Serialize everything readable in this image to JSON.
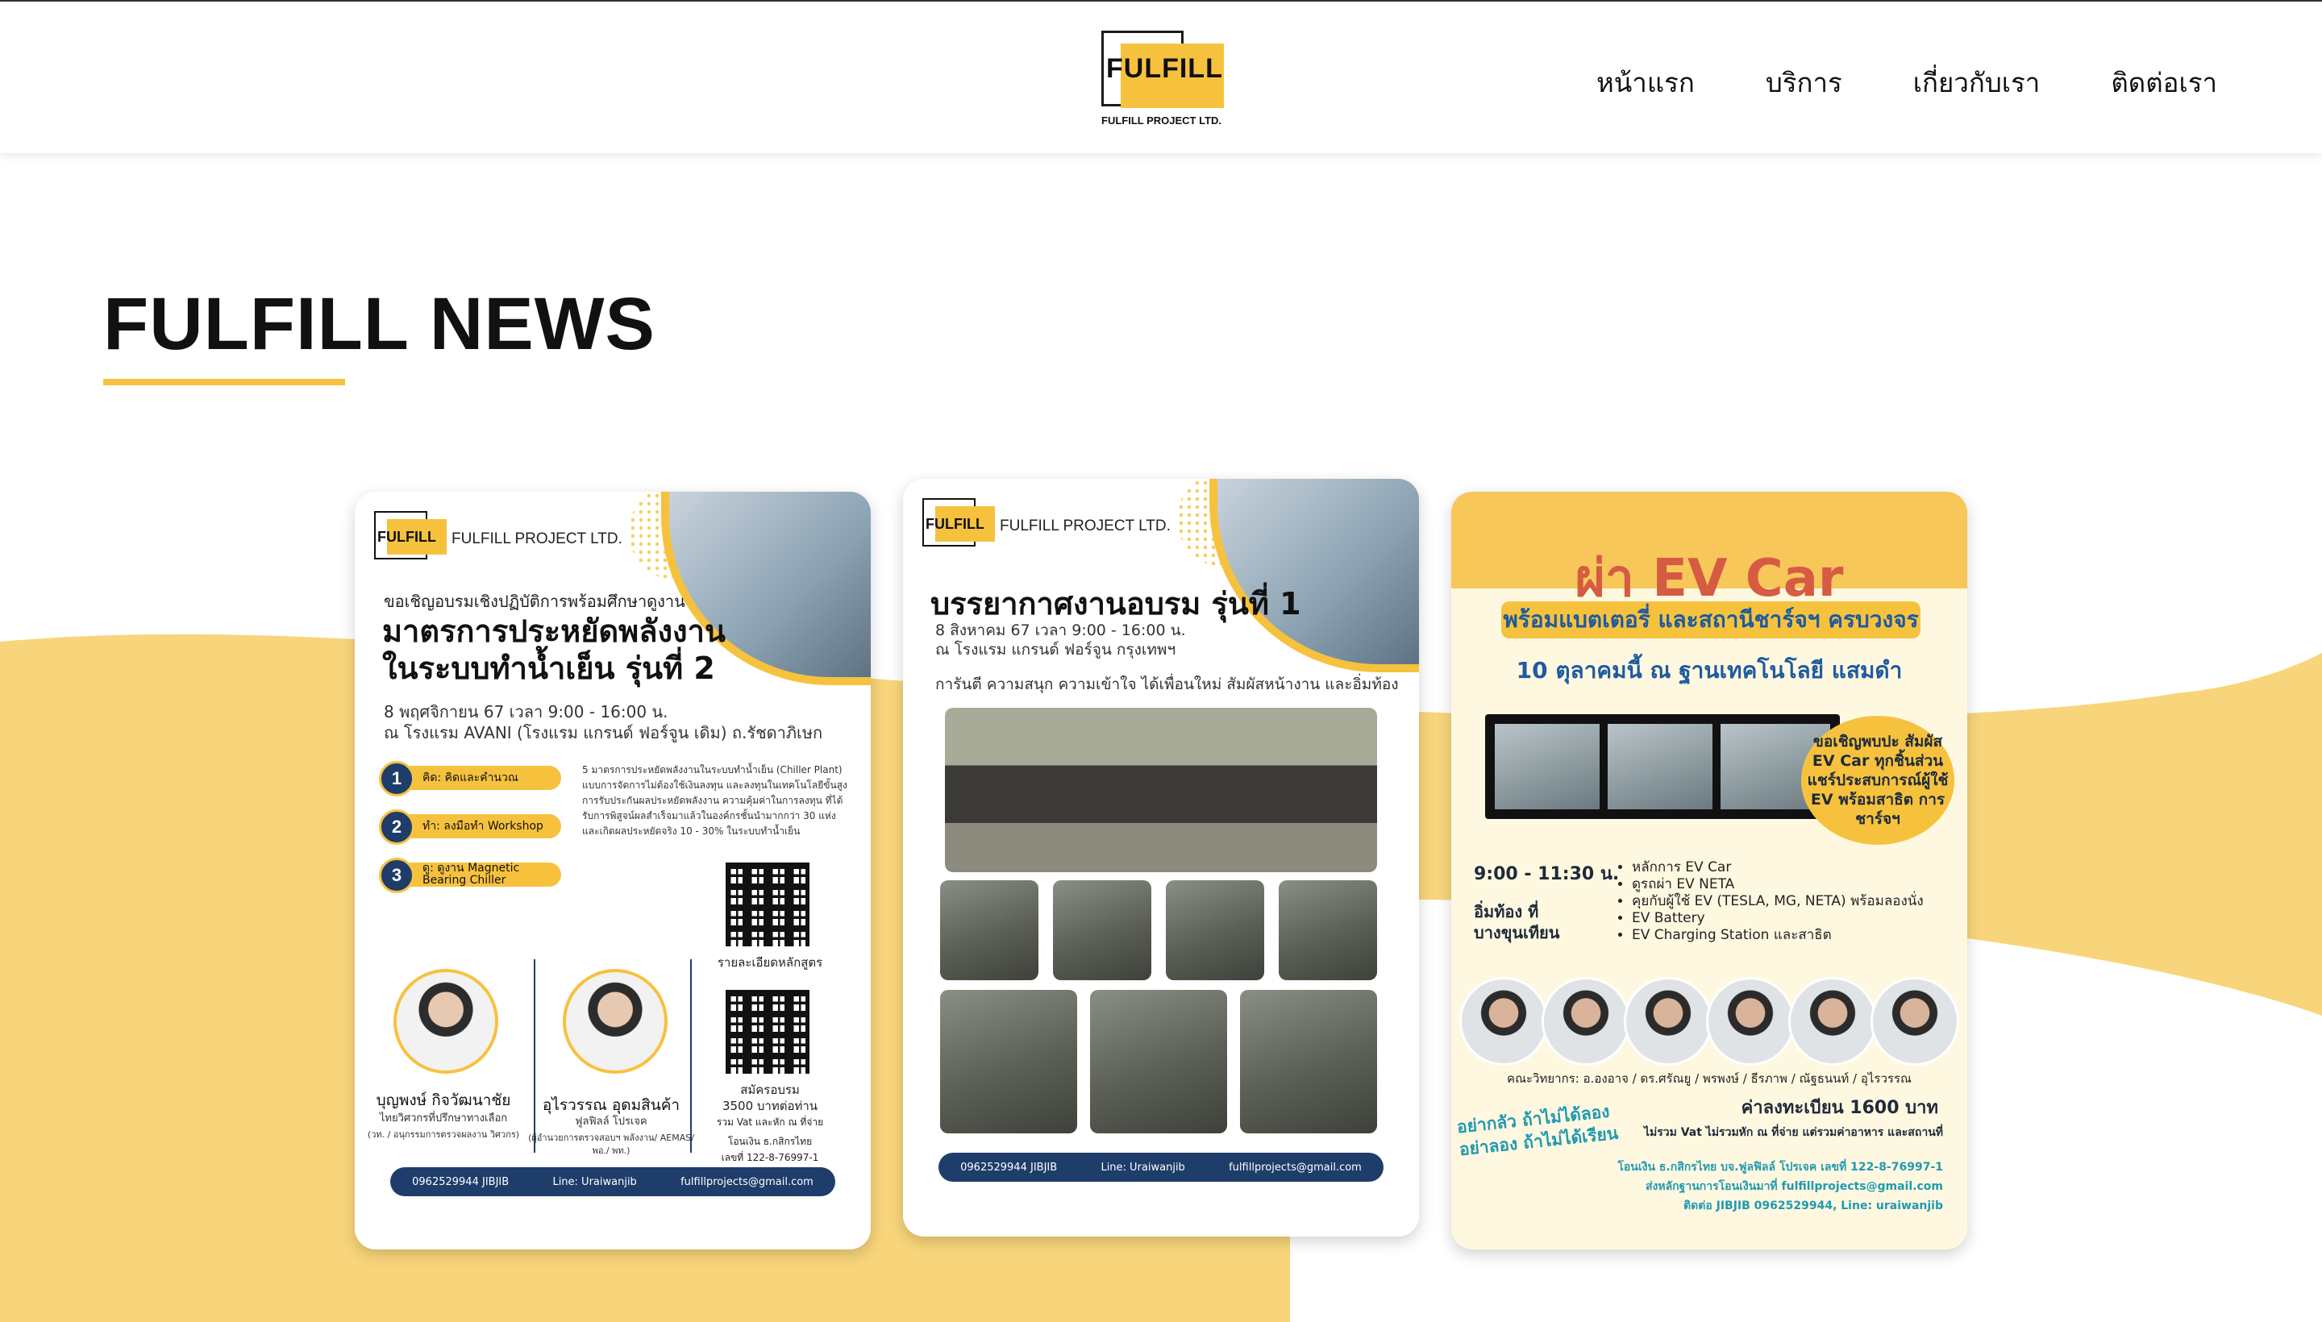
{
  "header": {
    "logo_text": "FULFILL",
    "logo_sub": "FULFILL PROJECT LTD.",
    "nav": [
      {
        "label": "หน้าแรก"
      },
      {
        "label": "บริการ"
      },
      {
        "label": "เกี่ยวกับเรา"
      },
      {
        "label": "ติดต่อเรา"
      }
    ]
  },
  "section": {
    "title": "FULFILL NEWS"
  },
  "colors": {
    "accent": "#f6c23e",
    "navy": "#1e3d6b",
    "background_wave": "#f8d57a"
  },
  "cards": [
    {
      "company": "FULFILL PROJECT LTD.",
      "kicker": "ขอเชิญอบรมเชิงปฏิบัติการพร้อมศึกษาดูงาน",
      "title_line1": "มาตรการประหยัดพลังงาน",
      "title_line2": "ในระบบทำน้ำเย็น รุ่นที่ 2",
      "date": "8 พฤศจิกายน 67 เวลา 9:00 - 16:00 น.",
      "venue": "ณ โรงแรม AVANI (โรงแรม แกรนด์ ฟอร์จูน เดิม) ถ.รัชดาภิเษก",
      "steps": [
        {
          "num": "1",
          "label": "คิด: คิดและคำนวณ"
        },
        {
          "num": "2",
          "label": "ทำ: ลงมือทำ Workshop"
        },
        {
          "num": "3",
          "label": "ดู: ดูงาน Magnetic Bearing Chiller"
        }
      ],
      "description": "5 มาตรการประหยัดพลังงานในระบบทำน้ำเย็น (Chiller Plant) แบบการจัดการไม่ต้องใช้เงินลงทุน และลงทุนในเทคโนโลยีขั้นสูง การรับประกันผลประหยัดพลังงาน ความคุ้มค่าในการลงทุน ที่ได้รับการพิสูจน์ผลสำเร็จมาแล้วในองค์กรชั้นนำมากกว่า 30 แห่ง และเกิดผลประหยัดจริง 10 - 30% ในระบบทำน้ำเย็น",
      "qr1_label": "รายละเอียดหลักสูตร",
      "qr2_label": "สมัครอบรม",
      "price": "3500 บาทต่อท่าน",
      "price_note": "รวม Vat และหัก ณ ที่จ่าย",
      "bank": "โอนเงิน ธ.กสิกรไทย",
      "account": "เลขที่ 122-8-76997-1",
      "speaker1_name": "บุญพงษ์ กิจวัฒนาชัย",
      "speaker1_role": "ไทยวิศวกรที่ปรึกษาทางเลือก",
      "speaker1_role2": "(วท. / อนุกรรมการตรวจผลงาน วิศวกร)",
      "speaker2_name": "อุไรวรรณ อุดมสินค้า",
      "speaker2_role": "ฟูลฟิลล์ โปรเจค",
      "speaker2_role2": "(ผู้อำนวยการตรวจสอบฯ พลังงาน/ AEMAS/ พอ./ พท.)",
      "footer": [
        "0962529944 JIBJIB",
        "Line: Uraiwanjib",
        "fulfillprojects@gmail.com"
      ]
    },
    {
      "company": "FULFILL PROJECT LTD.",
      "title": "บรรยากาศงานอบรม รุ่นที่ 1",
      "date": "8 สิงหาคม 67 เวลา 9:00 - 16:00 น.",
      "venue": "ณ โรงแรม แกรนด์ ฟอร์จูน กรุงเทพฯ",
      "tagline": "การันตี ความสนุก ความเข้าใจ ได้เพื่อนใหม่ สัมผัสหน้างาน และอิ่มท้อง",
      "footer": [
        "0962529944 JIBJIB",
        "Line: Uraiwanjib",
        "fulfillprojects@gmail.com"
      ]
    },
    {
      "title": "ผ่า EV Car",
      "banner": "พร้อมแบตเตอรี่ และสถานีชาร์จฯ ครบวงจร",
      "date": "10 ตุลาคมนี้ ณ ฐานเทคโนโลยี แสมดำ",
      "bubble": "ขอเชิญพบปะ สัมผัส EV Car ทุกชิ้นส่วน แชร์ประสบการณ์ผู้ใช้ EV พร้อมสาธิต การชาร์จฯ",
      "time": "9:00 - 11:30 น.",
      "lunch": "อิ่มท้อง ที่ บางขุนเทียน",
      "topics": [
        "หลักการ EV Car",
        "ดูรถผ่า EV NETA",
        "คุยกับผู้ใช้ EV (TESLA, MG, NETA) พร้อมลองนั่ง",
        "EV Battery",
        "EV Charging Station และสาธิต"
      ],
      "speakers": "คณะวิทยากร: อ.องอาจ / ดร.ศรัณยู / พรพงษ์ / ธีรภาพ / ณัฐธนนท์ / อุไรวรรณ",
      "fee": "ค่าลงทะเบียน 1600 บาท",
      "vat_note": "ไม่รวม Vat ไม่รวมหัก ณ ที่จ่าย แต่รวมค่าอาหาร และสถานที่",
      "slogan_line1": "อย่ากลัว ถ้าไม่ได้ลอง",
      "slogan_line2": "อย่าลอง ถ้าไม่ได้เรียน",
      "pay1": "โอนเงิน ธ.กสิกรไทย บจ.ฟูลฟิลล์ โปรเจค เลขที่ 122-8-76997-1",
      "pay2": "ส่งหลักฐานการโอนเงินมาที่ fulfillprojects@gmail.com",
      "pay3": "ติดต่อ JIBJIB 0962529944, Line: uraiwanjib"
    }
  ]
}
